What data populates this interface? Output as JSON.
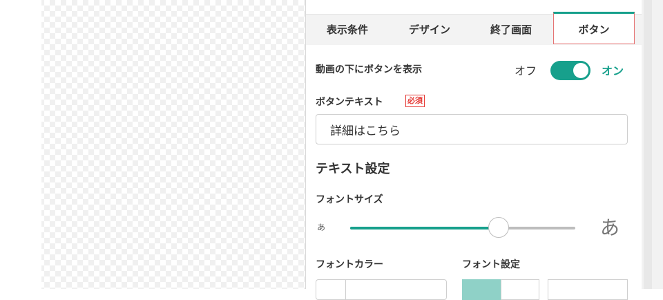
{
  "tabs": [
    {
      "label": "表示条件"
    },
    {
      "label": "デザイン"
    },
    {
      "label": "終了画面"
    },
    {
      "label": "ボタン"
    }
  ],
  "show_button": {
    "label": "動画の下にボタンを表示",
    "off_label": "オフ",
    "on_label": "オン",
    "state": "on"
  },
  "button_text": {
    "label": "ボタンテキスト",
    "required_badge": "必須",
    "value": "詳細はこちら"
  },
  "text_settings": {
    "title": "テキスト設定",
    "font_size": {
      "label": "フォントサイズ",
      "small_glyph": "あ",
      "large_glyph": "あ",
      "value_fraction": 0.66
    },
    "font_color_label": "フォントカラー",
    "font_setting_label": "フォント設定"
  },
  "colors": {
    "accent": "#17a08c",
    "required": "#e53935",
    "active_tab_outline": "#e57373"
  }
}
